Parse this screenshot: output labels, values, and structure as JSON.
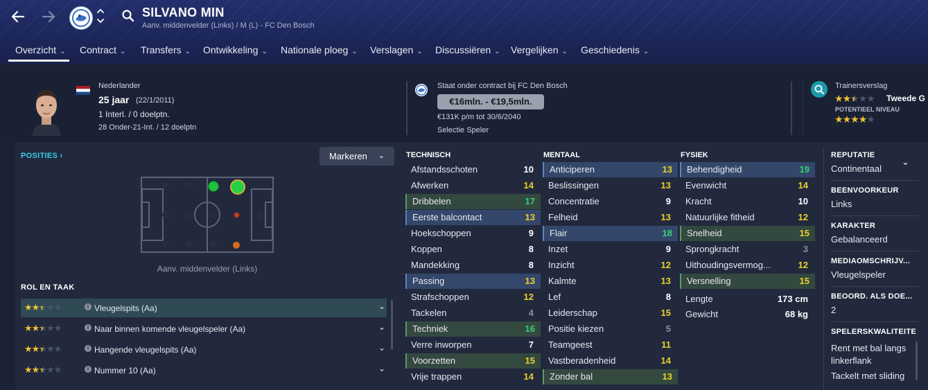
{
  "header": {
    "player_name": "SILVANO MIN",
    "subtitle": "Aanv. middenvelder (Links) / M (L) - FC Den Bosch",
    "icons": [
      "back-arrow-icon",
      "forward-arrow-icon",
      "club-crest-icon",
      "search-icon"
    ]
  },
  "menu": {
    "items": [
      {
        "label": "Overzicht"
      },
      {
        "label": "Contract"
      },
      {
        "label": "Transfers"
      },
      {
        "label": "Ontwikkeling"
      },
      {
        "label": "Nationale ploeg"
      },
      {
        "label": "Verslagen"
      },
      {
        "label": "Discussiëren"
      },
      {
        "label": "Vergelijken"
      },
      {
        "label": "Geschiedenis"
      }
    ]
  },
  "profile": {
    "nationality": "Nederlander",
    "age": "25 jaar",
    "birthdate": "(22/1/2011)",
    "caps": "1 Interl. / 0 doelptn.",
    "u21": "28 Onder-21-Int. / 12 doelptn"
  },
  "contract": {
    "status": "Staat onder contract bij FC Den Bosch",
    "value_range": "€16mln. - €19,5mln.",
    "wage": "€131K p/m tot 30/6/2040",
    "squad_status": "Selectie Speler"
  },
  "scout": {
    "title": "Trainersverslag",
    "current_label": "Tweede G",
    "potential_label": "POTENTIEEL NIVEAU",
    "current_stars": 2.5,
    "potential_stars": 4
  },
  "positions": {
    "title": "POSITIES",
    "dropdown": "Markeren",
    "caption": "Aanv. middenvelder (Links)"
  },
  "roles": {
    "title": "ROL EN TAAK",
    "items": [
      {
        "name": "Vleugelspits (Aa)",
        "stars": 2.5
      },
      {
        "name": "Naar binnen komende vleugelspeler (Aa)",
        "stars": 2.5
      },
      {
        "name": "Hangende vleugelspits (Aa)",
        "stars": 2.5
      },
      {
        "name": "Nummer 10 (Aa)",
        "stars": 2.5
      }
    ]
  },
  "technical": {
    "title": "TECHNISCH",
    "rows": [
      {
        "name": "Afstandsschoten",
        "value": "10"
      },
      {
        "name": "Afwerken",
        "value": "14"
      },
      {
        "name": "Dribbelen",
        "value": "17"
      },
      {
        "name": "Eerste balcontact",
        "value": "13"
      },
      {
        "name": "Hoekschoppen",
        "value": "9"
      },
      {
        "name": "Koppen",
        "value": "8"
      },
      {
        "name": "Mandekking",
        "value": "8"
      },
      {
        "name": "Passing",
        "value": "13"
      },
      {
        "name": "Strafschoppen",
        "value": "12"
      },
      {
        "name": "Tackelen",
        "value": "4"
      },
      {
        "name": "Techniek",
        "value": "16"
      },
      {
        "name": "Verre inworpen",
        "value": "7"
      },
      {
        "name": "Voorzetten",
        "value": "15"
      },
      {
        "name": "Vrije trappen",
        "value": "14"
      }
    ]
  },
  "mental": {
    "title": "MENTAAL",
    "rows": [
      {
        "name": "Anticiperen",
        "value": "13"
      },
      {
        "name": "Beslissingen",
        "value": "13"
      },
      {
        "name": "Concentratie",
        "value": "9"
      },
      {
        "name": "Felheid",
        "value": "13"
      },
      {
        "name": "Flair",
        "value": "18"
      },
      {
        "name": "Inzet",
        "value": "9"
      },
      {
        "name": "Inzicht",
        "value": "12"
      },
      {
        "name": "Kalmte",
        "value": "13"
      },
      {
        "name": "Lef",
        "value": "8"
      },
      {
        "name": "Leiderschap",
        "value": "15"
      },
      {
        "name": "Positie kiezen",
        "value": "5"
      },
      {
        "name": "Teamgeest",
        "value": "11"
      },
      {
        "name": "Vastberadenheid",
        "value": "14"
      },
      {
        "name": "Zonder bal",
        "value": "13"
      }
    ]
  },
  "physical": {
    "title": "FYSIEK",
    "rows": [
      {
        "name": "Behendigheid",
        "value": "19"
      },
      {
        "name": "Evenwicht",
        "value": "14"
      },
      {
        "name": "Kracht",
        "value": "10"
      },
      {
        "name": "Natuurlijke fitheid",
        "value": "12"
      },
      {
        "name": "Snelheid",
        "value": "15"
      },
      {
        "name": "Sprongkracht",
        "value": "3"
      },
      {
        "name": "Uithoudingsvermog...",
        "value": "12"
      },
      {
        "name": "Versnelling",
        "value": "15"
      }
    ],
    "height_label": "Lengte",
    "height": "173 cm",
    "weight_label": "Gewicht",
    "weight": "68 kg"
  },
  "sidebar": {
    "reputation_label": "REPUTATIE",
    "reputation": "Continentaal",
    "foot_label": "BEENVOORKEUR",
    "foot": "Links",
    "character_label": "KARAKTER",
    "character": "Gebalanceerd",
    "media_label": "MEDIAOMSCHRIJV...",
    "media": "Vleugelspeler",
    "rating_label": "BEOORD. ALS DOE...",
    "rating": "2",
    "traits_label": "SPELERSKWALITEITE",
    "trait1a": "Rent met bal langs",
    "trait1b": "linkerflank",
    "trait2": "Tackelt met sliding"
  },
  "colors": {
    "header_bg": "#232f6e",
    "panel_bg": "#22293d",
    "accent_cyan": "#35d0e8",
    "value_green": "#34d27a",
    "value_yellow": "#e8d22a",
    "highlight_blue": "#34476a",
    "highlight_green": "#33483f"
  }
}
